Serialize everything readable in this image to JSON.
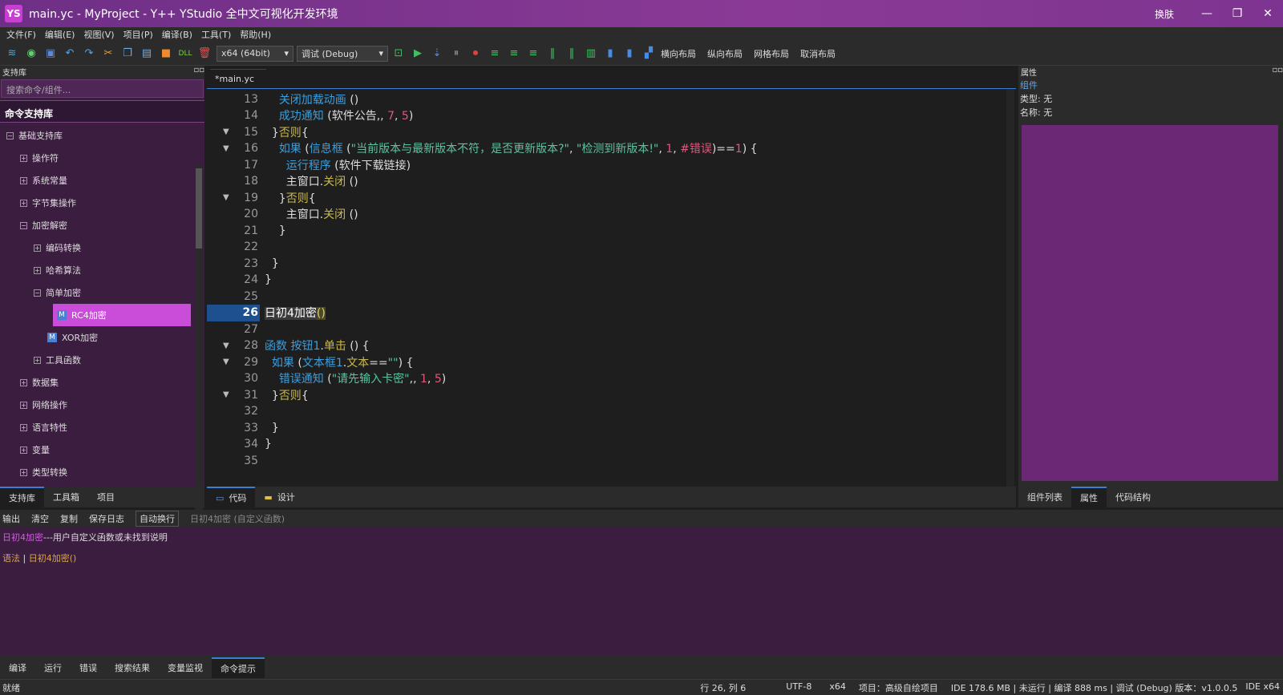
{
  "window": {
    "logo": "YS",
    "title": "main.yc - MyProject - Y++ YStudio 全中文可视化开发环境",
    "skin_label": "换肤",
    "min_icon": "minimize-icon",
    "max_icon": "maximize-icon",
    "close_icon": "close-icon"
  },
  "menu": [
    "文件(F)",
    "编辑(E)",
    "视图(V)",
    "项目(P)",
    "编译(B)",
    "工具(T)",
    "帮助(H)"
  ],
  "toolbar": {
    "platform": "x64 (64bit)",
    "config": "调试 (Debug)",
    "layout_h": "横向布局",
    "layout_v": "纵向布局",
    "layout_grid": "网格布局",
    "layout_cancel": "取消布局"
  },
  "left_panel": {
    "title": "支持库",
    "search_placeholder": "搜索命令/组件...",
    "lib_header": "命令支持库",
    "tree": [
      {
        "label": "基础支持库",
        "level": 0,
        "exp": "−"
      },
      {
        "label": "操作符",
        "level": 1,
        "exp": "+"
      },
      {
        "label": "系统常量",
        "level": 1,
        "exp": "+"
      },
      {
        "label": "字节集操作",
        "level": 1,
        "exp": "+"
      },
      {
        "label": "加密解密",
        "level": 1,
        "exp": "−"
      },
      {
        "label": "编码转换",
        "level": 2,
        "exp": "+"
      },
      {
        "label": "哈希算法",
        "level": 2,
        "exp": "+"
      },
      {
        "label": "简单加密",
        "level": 2,
        "exp": "−"
      },
      {
        "label": "RC4加密",
        "level": 3,
        "exp": "M",
        "selected": true
      },
      {
        "label": "XOR加密",
        "level": 3,
        "exp": "M"
      },
      {
        "label": "工具函数",
        "level": 2,
        "exp": "+"
      },
      {
        "label": "数据集",
        "level": 1,
        "exp": "+"
      },
      {
        "label": "网络操作",
        "level": 1,
        "exp": "+"
      },
      {
        "label": "语言特性",
        "level": 1,
        "exp": "+"
      },
      {
        "label": "变量",
        "level": 1,
        "exp": "+"
      },
      {
        "label": "类型转换",
        "level": 1,
        "exp": "+"
      }
    ],
    "tabs": [
      "支持库",
      "工具箱",
      "项目"
    ]
  },
  "editor": {
    "file_tab": "*main.yc",
    "lines": [
      {
        "n": "13",
        "fold": "",
        "html": "    <span class='fn'>关闭加载动画</span> ()"
      },
      {
        "n": "14",
        "fold": "",
        "html": "    <span class='fn'>成功通知</span> (软件公告,, <span class='num'>7</span>, <span class='num'>5</span>)"
      },
      {
        "n": "15",
        "fold": "▼",
        "html": "  }<span class='kw'>否则</span>{"
      },
      {
        "n": "16",
        "fold": "▼",
        "html": "    <span class='fn'>如果</span> (<span class='fn'>信息框</span> (<span class='str'>\"当前版本与最新版本不符，是否更新版本?\"</span>, <span class='str'>\"检测到新版本!\"</span>, <span class='num'>1</span>, <span class='red'>#错误</span>)==<span class='num'>1</span>) {"
      },
      {
        "n": "17",
        "fold": "",
        "html": "      <span class='fn'>运行程序</span> (软件下载链接)"
      },
      {
        "n": "18",
        "fold": "",
        "html": "      主窗口.<span class='kw'>关闭</span> ()"
      },
      {
        "n": "19",
        "fold": "▼",
        "html": "    }<span class='kw'>否则</span>{"
      },
      {
        "n": "20",
        "fold": "",
        "html": "      主窗口.<span class='kw'>关闭</span> ()"
      },
      {
        "n": "21",
        "fold": "",
        "html": "    }"
      },
      {
        "n": "22",
        "fold": "",
        "html": ""
      },
      {
        "n": "23",
        "fold": "",
        "html": "  }"
      },
      {
        "n": "24",
        "fold": "",
        "html": "}"
      },
      {
        "n": "25",
        "fold": "",
        "html": ""
      },
      {
        "n": "26",
        "fold": "",
        "html": "<span style='background:#3a3a3a;color:#fff'>日初4加密</span><span style='background:#4a4a2a;color:#e0d060'>()</span>",
        "current": true
      },
      {
        "n": "27",
        "fold": "",
        "html": ""
      },
      {
        "n": "28",
        "fold": "▼",
        "html": "<span class='fn'>函数</span> <span class='fn'>按钮1</span>.<span class='kw'>单击</span> () {"
      },
      {
        "n": "29",
        "fold": "▼",
        "html": "  <span class='fn'>如果</span> (<span class='fn'>文本框1</span>.<span class='kw'>文本</span>==<span class='str'>\"\"</span>) {"
      },
      {
        "n": "30",
        "fold": "",
        "html": "    <span class='fn'>错误通知</span> (<span class='str'>\"请先输入卡密\"</span>,, <span class='num'>1</span>, <span class='num'>5</span>)"
      },
      {
        "n": "31",
        "fold": "▼",
        "html": "  }<span class='kw'>否则</span>{"
      },
      {
        "n": "32",
        "fold": "",
        "html": ""
      },
      {
        "n": "33",
        "fold": "",
        "html": "  }"
      },
      {
        "n": "34",
        "fold": "",
        "html": "}"
      },
      {
        "n": "35",
        "fold": "",
        "html": ""
      }
    ],
    "tabs": [
      {
        "label": "代码",
        "icon": "code-view-icon"
      },
      {
        "label": "设计",
        "icon": "design-view-icon"
      }
    ]
  },
  "properties": {
    "title": "属性",
    "component": "组件",
    "type": "类型: 无",
    "name": "名称: 无",
    "tabs": [
      "组件列表",
      "属性",
      "代码结构"
    ]
  },
  "output": {
    "toolbar": [
      "输出",
      "清空",
      "复制",
      "保存日志",
      "自动换行"
    ],
    "hint": "日初4加密 (自定义函数)",
    "msg_name": "日初4加密",
    "msg_rest": "---用户自定义函数或未找到说明",
    "syntax_label": "语法",
    "syntax_value": "日初4加密()"
  },
  "bottom_tabs": [
    "编译",
    "运行",
    "错误",
    "搜索结果",
    "变量监视",
    "命令提示"
  ],
  "status": {
    "left": "就绪",
    "position": "行 26, 列 6",
    "encoding": "UTF-8",
    "arch": "x64",
    "project": "项目：高级自绘项目",
    "ide": "IDE 178.6 MB | 未运行 | 编译 888 ms | 调试 (Debug) 版本：v1.0.0.5",
    "arch2": "IDE x64"
  },
  "colors": {
    "accent": "#c94dd9",
    "title_bg": "#7d3490",
    "panel_bg": "#3b1d40",
    "prop_fill": "#6b2874"
  }
}
